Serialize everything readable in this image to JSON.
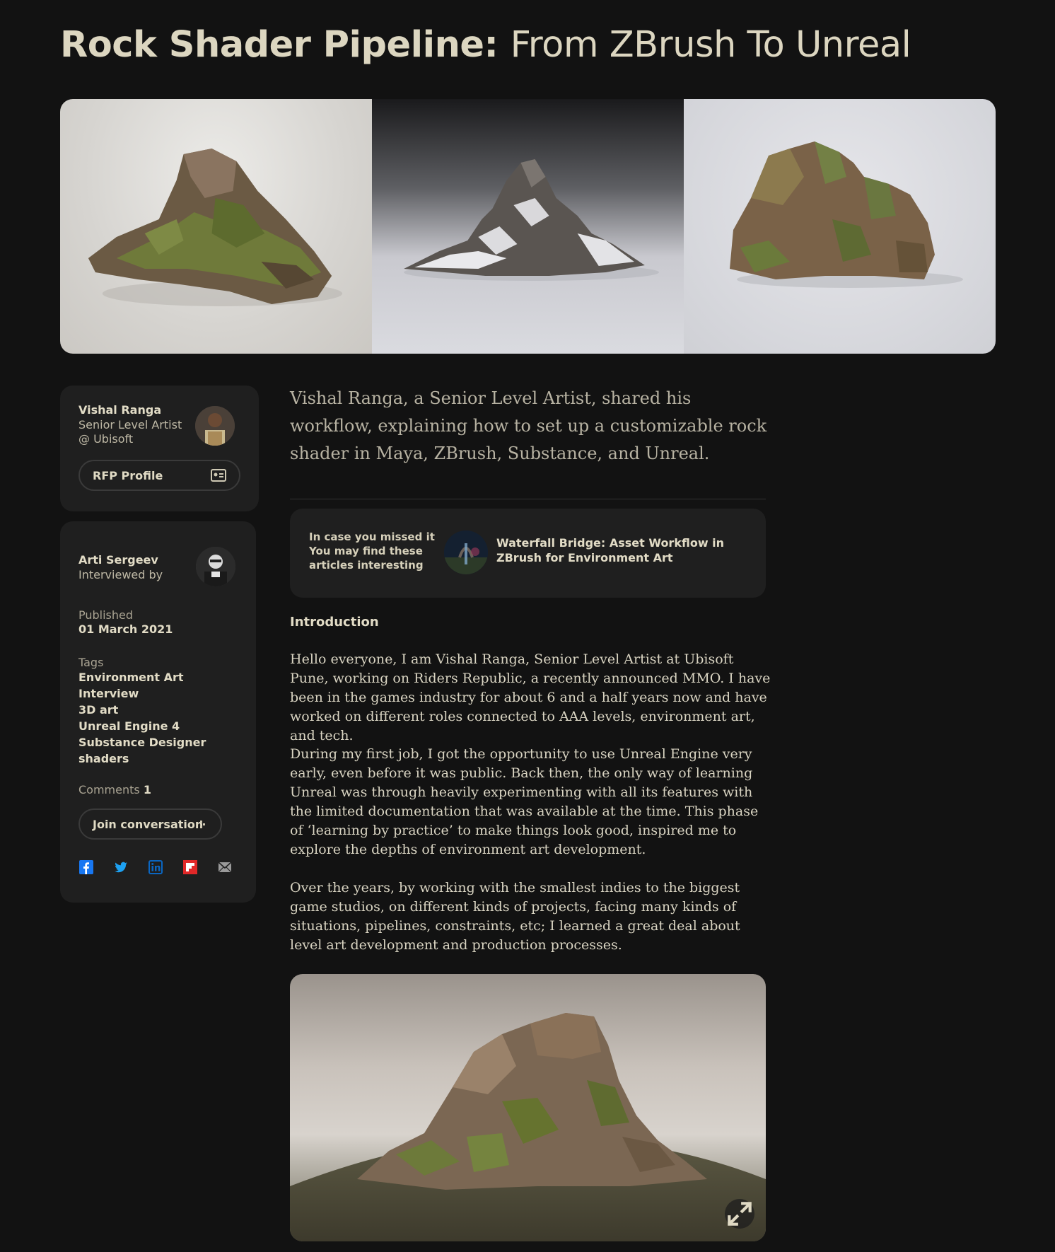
{
  "article": {
    "title_bold": "Rock Shader Pipeline:",
    "title_light": "From ZBrush To Unreal",
    "lead": "Vishal Ranga, a Senior Level Artist, shared his workflow, explaining how to set up a customizable rock shader in Maya, ZBrush, Substance, and Unreal.",
    "section_heading": "Introduction",
    "paragraphs": [
      "Hello everyone, I am Vishal Ranga, Senior Level Artist at Ubisoft Pune, working on Riders Republic, a recently announced MMO. I have been in the games industry for about 6 and a half years now and have worked on different roles connected to AAA levels, environment art, and tech.",
      "During my first job, I got the opportunity to use Unreal Engine very early, even before it was public. Back then, the only way of learning Unreal was through heavily experimenting with all its features with the limited documentation that was available at the time. This phase of ‘learning by practice’ to make things look good, inspired me to explore the depths of environment art development.",
      "Over the years, by working with the smallest indies to the biggest game studios, on different kinds of projects, facing many kinds of situations, pipelines, constraints, etc; I learned a great deal about level art development and production processes."
    ]
  },
  "author": {
    "name": "Vishal Ranga",
    "role": "Senior Level Artist",
    "company": "@ Ubisoft",
    "profile_button": "RFP Profile"
  },
  "info": {
    "interviewer_name": "Arti Sergeev",
    "interviewer_label": "Interviewed by",
    "published_label": "Published",
    "published_date": "01 March 2021",
    "tags_label": "Tags",
    "tags": [
      "Environment Art",
      "Interview",
      "3D art",
      "Unreal Engine 4",
      "Substance Designer",
      "shaders"
    ],
    "comments_label": "Comments",
    "comments_count": "1",
    "join_button": "Join conversation"
  },
  "missed": {
    "label_line1": "In case you missed it",
    "label_line2": "You may find these articles interesting",
    "link_title": "Waterfall Bridge: Asset Workflow in ZBrush for Environment Art"
  },
  "social": {
    "icons": [
      "facebook-icon",
      "twitter-icon",
      "linkedin-icon",
      "flipboard-icon",
      "email-icon"
    ],
    "colors": {
      "facebook": "#1877f2",
      "twitter": "#1da1f2",
      "linkedin": "#0a66c2",
      "flipboard": "#e12828",
      "email": "#9a9a9a"
    }
  }
}
